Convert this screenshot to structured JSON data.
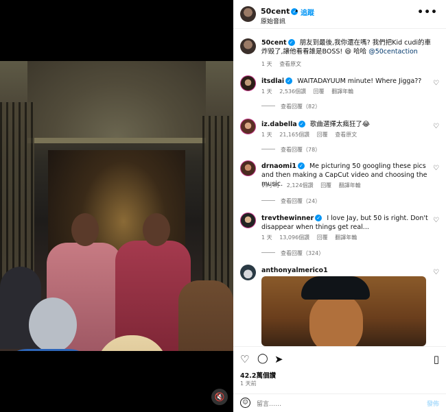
{
  "post": {
    "username": "50cent",
    "dot": "•",
    "follow_label": "追蹤",
    "audio_label": "原始音訊",
    "more_icon": "•••"
  },
  "caption": {
    "username": "50cent",
    "text": "朋友到最後,我你還在嗎? 我們把Kid cudi的車炸毀了,讓他看看誰是BOSS! 😆 哈哈 ",
    "mention": "@50centaction",
    "time": "1 天",
    "translate": "查看原文"
  },
  "comments": [
    {
      "username": "itsdlai",
      "text": "WAITADAYUUM minute! Where Jigga??",
      "time": "1 天",
      "likes": "2,536個讚",
      "reply": "回覆",
      "translate": "翻譯年輪",
      "replies": "查看回覆（82）"
    },
    {
      "username": "iz.dabella",
      "text": "歌曲選擇太瘋狂了😂",
      "time": "1 天",
      "likes": "21,165個讚",
      "reply": "回覆",
      "translate": "查看原文",
      "replies": "查看回覆（78）"
    },
    {
      "username": "drnaomi1",
      "text": "Me picturing 50 googling these pics and then making a CapCut video and choosing the music.",
      "time": "19小時",
      "likes": "2,124個讚",
      "reply": "回覆",
      "translate": "翻譯年輪",
      "replies": "查看回覆（24）"
    },
    {
      "username": "trevthewinner",
      "text": "I love Jay, but 50 is right. Don't disappear when things get real...",
      "time": "1 天",
      "likes": "13,096個讚",
      "reply": "回覆",
      "translate": "翻譯年輪",
      "replies": "查看回覆（324）"
    },
    {
      "username": "anthonyalmerico1"
    }
  ],
  "actions": {
    "like_icon": "♡",
    "comment_icon": "◯",
    "share_icon": "➤",
    "save_icon": "▯",
    "likes_count": "42.2萬個讚",
    "posted_ago": "1 天前"
  },
  "add_comment": {
    "placeholder": "留言……",
    "post_label": "發佈"
  },
  "icons": {
    "mute": "🔇",
    "heart_small": "♡",
    "verified": "✓",
    "emoji": "☺"
  },
  "colors": {
    "link": "#00376b",
    "accent": "#0095f6",
    "muted": "#737373"
  }
}
